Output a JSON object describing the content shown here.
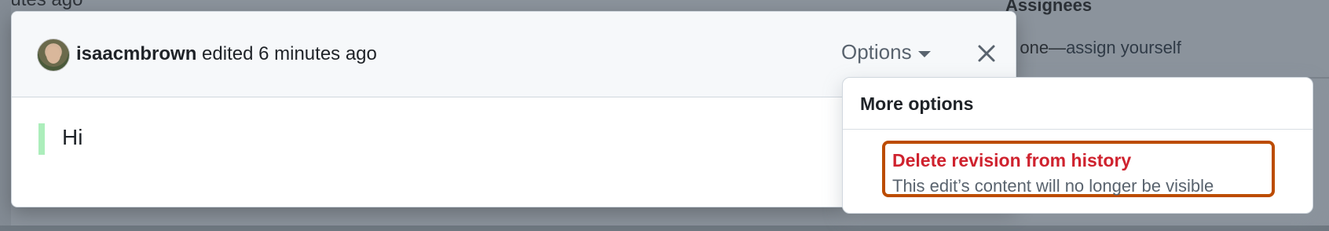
{
  "background": {
    "top_text": "nutes ago",
    "sidebar": {
      "heading": "Assignees",
      "assign_prefix": "o one—",
      "assign_link": "assign yourself"
    }
  },
  "modal": {
    "header": {
      "username": "isaacmbrown",
      "action_text": " edited 6 minutes ago",
      "options_label": "Options",
      "avatar_icon": "avatar",
      "options_caret_icon": "triangle-down-icon",
      "close_icon": "x-icon"
    },
    "body": {
      "content": "Hi"
    }
  },
  "dropdown": {
    "title": "More options",
    "items": [
      {
        "label": "Delete revision from history",
        "description": "This edit’s content will no longer be visible"
      }
    ]
  },
  "colors": {
    "danger": "#cf222e",
    "highlight_border": "#bc4c00",
    "added_line_marker": "#aceebb",
    "muted_text": "#59636e"
  }
}
